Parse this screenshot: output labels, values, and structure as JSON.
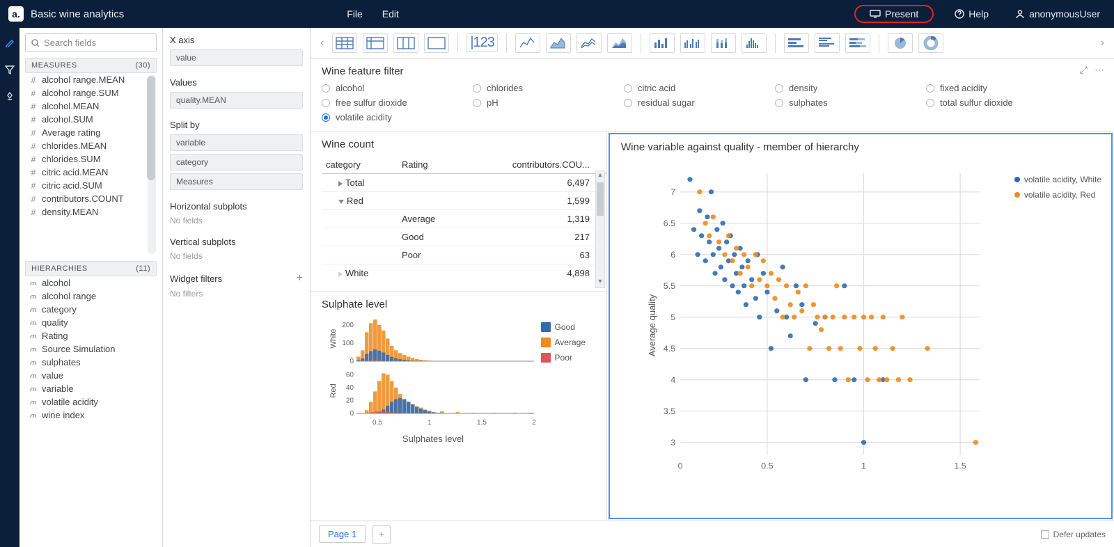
{
  "header": {
    "title": "Basic wine analytics",
    "menus": [
      "File",
      "Edit"
    ],
    "present": "Present",
    "help": "Help",
    "user": "anonymousUser"
  },
  "search_placeholder": "Search fields",
  "sections": {
    "measures": {
      "label": "MEASURES",
      "count": "(30)"
    },
    "hierarchies": {
      "label": "HIERARCHIES",
      "count": "(11)"
    }
  },
  "measures": [
    "alcohol range.MEAN",
    "alcohol range.SUM",
    "alcohol.MEAN",
    "alcohol.SUM",
    "Average rating",
    "chlorides.MEAN",
    "chlorides.SUM",
    "citric acid.MEAN",
    "citric acid.SUM",
    "contributors.COUNT",
    "density.MEAN"
  ],
  "hierarchies": [
    "alcohol",
    "alcohol range",
    "category",
    "quality",
    "Rating",
    "Source Simulation",
    "sulphates",
    "value",
    "variable",
    "volatile acidity",
    "wine index"
  ],
  "config": {
    "xaxis": {
      "label": "X axis",
      "chips": [
        "value"
      ]
    },
    "values": {
      "label": "Values",
      "chips": [
        "quality.MEAN"
      ]
    },
    "splitby": {
      "label": "Split by",
      "chips": [
        "variable",
        "category",
        "Measures"
      ]
    },
    "hsub": {
      "label": "Horizontal subplots",
      "empty": "No fields"
    },
    "vsub": {
      "label": "Vertical subplots",
      "empty": "No fields"
    },
    "wfilt": {
      "label": "Widget filters",
      "empty": "No filters"
    }
  },
  "filter_widget": {
    "title": "Wine feature filter",
    "options": [
      "alcohol",
      "chlorides",
      "citric acid",
      "density",
      "fixed acidity",
      "free sulfur dioxide",
      "pH",
      "residual sugar",
      "sulphates",
      "total sulfur dioxide",
      "volatile acidity"
    ],
    "selected": "volatile acidity"
  },
  "wine_count": {
    "title": "Wine count",
    "columns": [
      "category",
      "Rating",
      "contributors.COU..."
    ],
    "rows": [
      {
        "label": "Total",
        "value": "6,497",
        "level": 0,
        "expand": "right"
      },
      {
        "label": "Red",
        "value": "1,599",
        "level": 0,
        "expand": "down"
      },
      {
        "label": "Average",
        "value": "1,319",
        "level": 2
      },
      {
        "label": "Good",
        "value": "217",
        "level": 2
      },
      {
        "label": "Poor",
        "value": "63",
        "level": 2
      },
      {
        "label": "White",
        "value": "4,898",
        "level": 0,
        "expand": "right-dim"
      }
    ]
  },
  "sulphate": {
    "title": "Sulphate level",
    "xlabel": "Sulphates level",
    "legend": [
      {
        "label": "Good",
        "color": "#2f6bb5"
      },
      {
        "label": "Average",
        "color": "#f08a1c"
      },
      {
        "label": "Poor",
        "color": "#e15559"
      }
    ]
  },
  "scatter": {
    "title": "Wine variable against quality - member of hierarchy",
    "ylabel": "Average quality",
    "legend": [
      {
        "label": "volatile acidity, White",
        "color": "#2f6bb5"
      },
      {
        "label": "volatile acidity, Red",
        "color": "#f08a1c"
      }
    ]
  },
  "footer": {
    "page": "Page 1",
    "defer": "Defer updates"
  },
  "chart_data": {
    "sulphate_histograms": {
      "type": "bar",
      "xlabel": "Sulphates level",
      "x_range": [
        0.3,
        2.0
      ],
      "bin_width": 0.04,
      "facets": [
        {
          "facet": "White",
          "ylim": [
            0,
            250
          ],
          "yticks": [
            0,
            100,
            200
          ],
          "series": [
            {
              "name": "Average",
              "color": "#f08a1c",
              "x": [
                0.3,
                0.34,
                0.38,
                0.42,
                0.46,
                0.5,
                0.54,
                0.58,
                0.62,
                0.66,
                0.7,
                0.74,
                0.78,
                0.82,
                0.86,
                0.9,
                0.94,
                0.98,
                1.02,
                1.06
              ],
              "y": [
                25,
                60,
                160,
                210,
                230,
                200,
                170,
                125,
                85,
                60,
                45,
                35,
                25,
                18,
                12,
                8,
                5,
                3,
                2,
                1
              ]
            },
            {
              "name": "Good",
              "color": "#2f6bb5",
              "x": [
                0.3,
                0.34,
                0.38,
                0.42,
                0.46,
                0.5,
                0.54,
                0.58,
                0.62,
                0.66,
                0.7,
                0.74,
                0.78,
                0.82,
                0.86
              ],
              "y": [
                5,
                15,
                40,
                55,
                65,
                58,
                48,
                35,
                24,
                16,
                11,
                8,
                5,
                3,
                2
              ]
            },
            {
              "name": "Poor",
              "color": "#e15559",
              "x": [
                0.34,
                0.38,
                0.42,
                0.46,
                0.5,
                0.54,
                0.58,
                0.62
              ],
              "y": [
                1,
                3,
                5,
                6,
                5,
                3,
                2,
                1
              ]
            }
          ]
        },
        {
          "facet": "Red",
          "ylim": [
            0,
            70
          ],
          "yticks": [
            0,
            20,
            40,
            60
          ],
          "series": [
            {
              "name": "Average",
              "color": "#f08a1c",
              "x": [
                0.38,
                0.42,
                0.46,
                0.5,
                0.54,
                0.58,
                0.62,
                0.66,
                0.7,
                0.74,
                0.78,
                0.82,
                0.86,
                0.9,
                0.94,
                0.98,
                1.1,
                1.25,
                1.4,
                1.6,
                1.8,
                1.95
              ],
              "y": [
                5,
                18,
                34,
                50,
                62,
                60,
                50,
                40,
                30,
                22,
                18,
                14,
                11,
                9,
                6,
                4,
                3,
                2,
                1,
                1,
                1,
                1
              ]
            },
            {
              "name": "Good",
              "color": "#2f6bb5",
              "x": [
                0.5,
                0.54,
                0.58,
                0.62,
                0.66,
                0.7,
                0.74,
                0.78,
                0.82,
                0.86,
                0.9,
                0.94,
                0.98,
                1.02,
                1.06
              ],
              "y": [
                2,
                6,
                12,
                18,
                22,
                24,
                22,
                18,
                14,
                10,
                7,
                5,
                3,
                2,
                1
              ]
            },
            {
              "name": "Poor",
              "color": "#e15559",
              "x": [
                0.4,
                0.44,
                0.48,
                0.52,
                0.56,
                0.6,
                0.64,
                0.68
              ],
              "y": [
                1,
                2,
                3,
                3,
                2,
                2,
                1,
                1
              ]
            }
          ]
        }
      ]
    },
    "quality_scatter": {
      "type": "scatter",
      "xlabel": "",
      "ylabel": "Average quality",
      "xlim": [
        0.05,
        1.6
      ],
      "ylim": [
        2.8,
        7.3
      ],
      "xticks": [
        0.5,
        1.0,
        1.5
      ],
      "yticks": [
        3,
        3.5,
        4,
        4.5,
        5,
        5.5,
        6,
        6.5,
        7
      ],
      "series": [
        {
          "name": "volatile acidity, White",
          "color": "#2f6bb5",
          "x": [
            0.1,
            0.12,
            0.14,
            0.15,
            0.16,
            0.18,
            0.19,
            0.2,
            0.21,
            0.22,
            0.23,
            0.24,
            0.25,
            0.26,
            0.27,
            0.28,
            0.29,
            0.3,
            0.31,
            0.32,
            0.33,
            0.34,
            0.35,
            0.36,
            0.37,
            0.38,
            0.39,
            0.4,
            0.42,
            0.44,
            0.45,
            0.46,
            0.48,
            0.5,
            0.52,
            0.55,
            0.58,
            0.6,
            0.62,
            0.65,
            0.68,
            0.7,
            0.75,
            0.8,
            0.85,
            0.9,
            0.95,
            1.0,
            1.1
          ],
          "y": [
            7.2,
            6.4,
            6.0,
            6.7,
            6.3,
            5.9,
            6.6,
            6.2,
            7.0,
            6.0,
            5.7,
            6.4,
            6.1,
            5.8,
            6.5,
            5.6,
            6.2,
            5.9,
            6.3,
            5.5,
            6.0,
            5.7,
            5.4,
            6.1,
            5.8,
            5.5,
            5.2,
            5.9,
            5.6,
            5.3,
            6.0,
            5.0,
            5.7,
            5.4,
            4.5,
            5.1,
            5.8,
            5.0,
            4.7,
            5.5,
            5.2,
            4.0,
            4.9,
            5.0,
            4.0,
            5.5,
            4.0,
            3.0,
            4.0
          ]
        },
        {
          "name": "volatile acidity, Red",
          "color": "#f08a1c",
          "x": [
            0.15,
            0.18,
            0.2,
            0.22,
            0.25,
            0.28,
            0.3,
            0.32,
            0.34,
            0.36,
            0.38,
            0.4,
            0.42,
            0.44,
            0.46,
            0.48,
            0.5,
            0.52,
            0.54,
            0.56,
            0.58,
            0.6,
            0.62,
            0.64,
            0.66,
            0.68,
            0.7,
            0.72,
            0.74,
            0.76,
            0.78,
            0.8,
            0.82,
            0.84,
            0.86,
            0.88,
            0.9,
            0.92,
            0.95,
            0.98,
            1.0,
            1.02,
            1.04,
            1.06,
            1.08,
            1.1,
            1.12,
            1.15,
            1.18,
            1.2,
            1.24,
            1.33,
            1.58
          ],
          "y": [
            7.0,
            6.5,
            6.3,
            6.6,
            6.2,
            6.0,
            6.3,
            5.9,
            6.1,
            5.7,
            6.0,
            5.8,
            5.5,
            6.0,
            5.6,
            5.9,
            5.5,
            5.7,
            5.3,
            5.6,
            5.0,
            5.5,
            5.2,
            5.0,
            5.4,
            5.1,
            5.5,
            4.5,
            5.2,
            5.0,
            4.8,
            5.0,
            4.5,
            5.0,
            5.5,
            4.5,
            5.0,
            4.0,
            5.0,
            4.5,
            5.0,
            4.0,
            5.0,
            4.5,
            4.0,
            5.0,
            4.0,
            4.5,
            4.0,
            5.0,
            4.0,
            4.5,
            3.0
          ]
        }
      ]
    }
  }
}
